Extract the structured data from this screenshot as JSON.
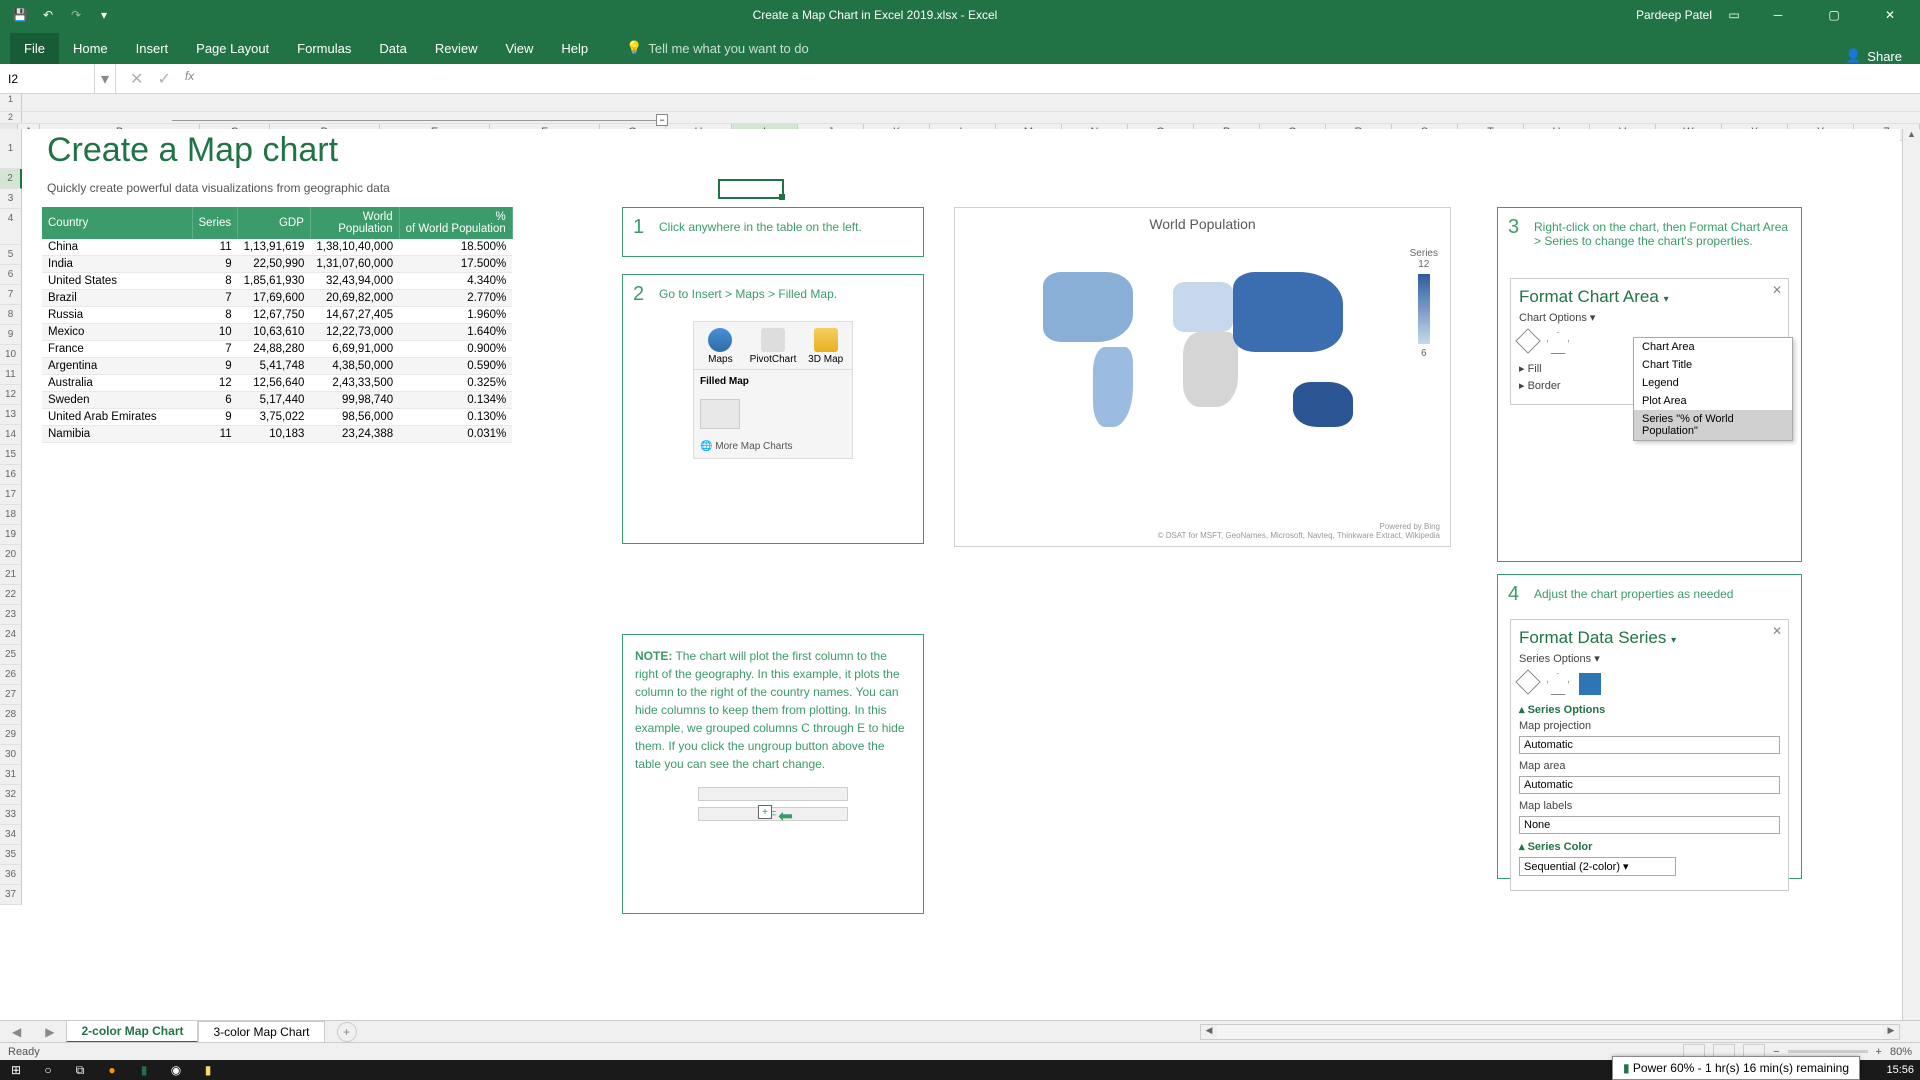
{
  "titlebar": {
    "filename": "Create a Map Chart in Excel 2019.xlsx - Excel",
    "user": "Pardeep Patel"
  },
  "ribbon": {
    "tabs": [
      "File",
      "Home",
      "Insert",
      "Page Layout",
      "Formulas",
      "Data",
      "Review",
      "View",
      "Help"
    ],
    "tell_me": "Tell me what you want to do",
    "share": "Share"
  },
  "formula": {
    "name_box": "I2"
  },
  "columns": [
    "A",
    "B",
    "C",
    "D",
    "E",
    "F",
    "G",
    "H",
    "I",
    "J",
    "K",
    "L",
    "M",
    "N",
    "O",
    "P",
    "Q",
    "R",
    "S",
    "T",
    "U",
    "V",
    "W",
    "X",
    "Y",
    "Z"
  ],
  "rows": [
    1,
    2,
    3,
    4,
    5,
    6,
    7,
    8,
    9,
    10,
    11,
    12,
    13,
    14,
    15,
    16,
    17,
    18,
    19,
    20,
    21,
    22,
    23,
    24,
    25,
    26,
    27,
    28,
    29,
    30,
    31,
    32,
    33,
    34,
    35,
    36,
    37
  ],
  "page": {
    "title": "Create a Map chart",
    "subtitle": "Quickly create powerful data visualizations from geographic data"
  },
  "table": {
    "headers": [
      "Country",
      "Series",
      "GDP",
      "World Population",
      "% of World Population"
    ],
    "rows": [
      [
        "China",
        "11",
        "1,13,91,619",
        "1,38,10,40,000",
        "18.500%"
      ],
      [
        "India",
        "9",
        "22,50,990",
        "1,31,07,60,000",
        "17.500%"
      ],
      [
        "United States",
        "8",
        "1,85,61,930",
        "32,43,94,000",
        "4.340%"
      ],
      [
        "Brazil",
        "7",
        "17,69,600",
        "20,69,82,000",
        "2.770%"
      ],
      [
        "Russia",
        "8",
        "12,67,750",
        "14,67,27,405",
        "1.960%"
      ],
      [
        "Mexico",
        "10",
        "10,63,610",
        "12,22,73,000",
        "1.640%"
      ],
      [
        "France",
        "7",
        "24,88,280",
        "6,69,91,000",
        "0.900%"
      ],
      [
        "Argentina",
        "9",
        "5,41,748",
        "4,38,50,000",
        "0.590%"
      ],
      [
        "Australia",
        "12",
        "12,56,640",
        "2,43,33,500",
        "0.325%"
      ],
      [
        "Sweden",
        "6",
        "5,17,440",
        "99,98,740",
        "0.134%"
      ],
      [
        "United Arab Emirates",
        "9",
        "3,75,022",
        "98,56,000",
        "0.130%"
      ],
      [
        "Namibia",
        "11",
        "10,183",
        "23,24,388",
        "0.031%"
      ]
    ]
  },
  "steps": {
    "s1": "Click anywhere in the table on the left.",
    "s2": "Go to Insert > Maps > Filled Map.",
    "s3": "Right-click on the chart, then Format Chart Area > Series to change the chart's properties.",
    "s4": "Adjust the chart properties as needed"
  },
  "ribbon_snippet": {
    "maps": "Maps",
    "pivot": "PivotChart",
    "map3d": "3D Map",
    "filled": "Filled Map",
    "more": "More Map Charts"
  },
  "note": {
    "label": "NOTE:",
    "text": "The chart will plot the first column to the right of the geography. In this example, it plots the column to the right of the country names. You can hide columns to keep them from plotting. In this example, we grouped columns C through E to hide them. If you click the ungroup button above the table you can see the chart change."
  },
  "chart": {
    "title": "World Population",
    "legend_label": "Series",
    "legend_max": "12",
    "legend_min": "6",
    "powered": "Powered by Bing",
    "credit": "© DSAT for MSFT, GeoNames, Microsoft, Navteq, Thinkware Extract, Wikipedia"
  },
  "format_area": {
    "title": "Format Chart Area",
    "sub": "Chart Options",
    "fill": "Fill",
    "border": "Border",
    "dropdown": [
      "Chart Area",
      "Chart Title",
      "Legend",
      "Plot Area",
      "Series \"% of World Population\""
    ]
  },
  "format_series": {
    "title": "Format Data Series",
    "sub": "Series Options",
    "hdr": "Series Options",
    "proj_label": "Map projection",
    "proj_value": "Automatic",
    "area_label": "Map area",
    "area_value": "Automatic",
    "labels_label": "Map labels",
    "labels_value": "None",
    "color_hdr": "Series Color",
    "color_value": "Sequential (2-color)"
  },
  "sheets": {
    "active": "2-color Map Chart",
    "other": "3-color Map Chart"
  },
  "status": {
    "ready": "Ready",
    "zoom": "80%"
  },
  "battery": "Power 60% - 1 hr(s) 16 min(s) remaining",
  "clock": "15:56",
  "ungroup_col": "F",
  "chart_data": {
    "type": "map",
    "title": "World Population",
    "series_name": "Series",
    "value_range": [
      6,
      12
    ],
    "data": [
      {
        "country": "China",
        "series": 11
      },
      {
        "country": "India",
        "series": 9
      },
      {
        "country": "United States",
        "series": 8
      },
      {
        "country": "Brazil",
        "series": 7
      },
      {
        "country": "Russia",
        "series": 8
      },
      {
        "country": "Mexico",
        "series": 10
      },
      {
        "country": "France",
        "series": 7
      },
      {
        "country": "Argentina",
        "series": 9
      },
      {
        "country": "Australia",
        "series": 12
      },
      {
        "country": "Sweden",
        "series": 6
      },
      {
        "country": "United Arab Emirates",
        "series": 9
      },
      {
        "country": "Namibia",
        "series": 11
      }
    ]
  }
}
